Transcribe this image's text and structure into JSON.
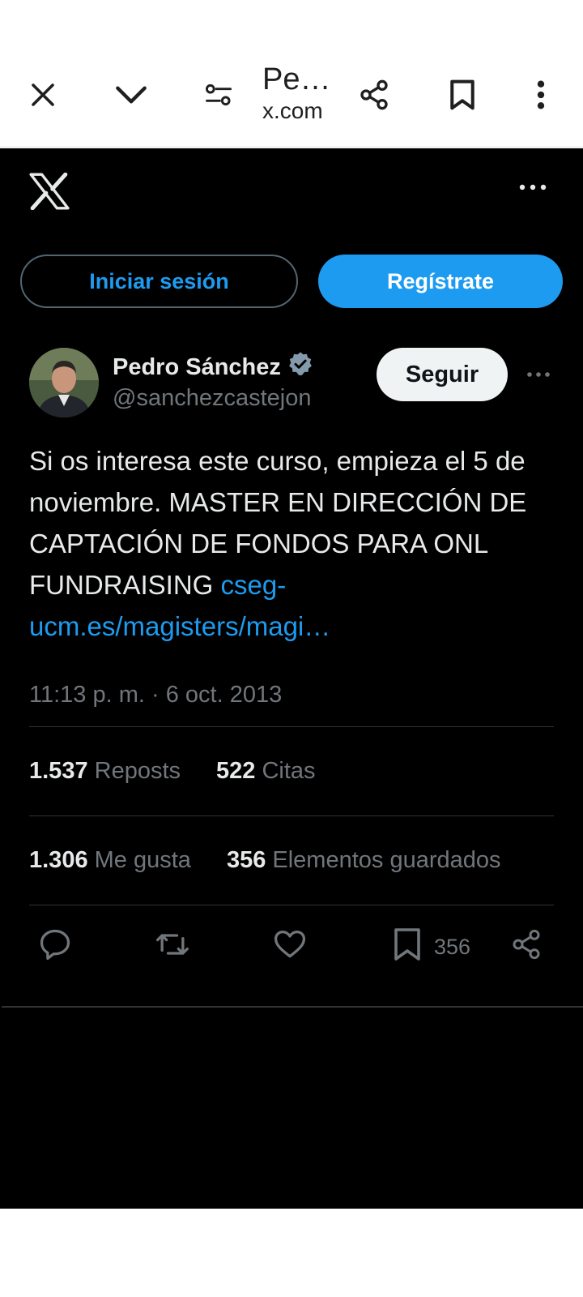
{
  "browser": {
    "title": "Pe…",
    "domain": "x.com",
    "icons": [
      "close-icon",
      "chevron-down-icon",
      "page-settings-icon",
      "share-icon",
      "bookmark-icon",
      "more-vert-icon"
    ]
  },
  "header": {
    "logo": "x-logo",
    "more": "more-horizontal-icon"
  },
  "auth": {
    "login_label": "Iniciar sesión",
    "signup_label": "Regístrate"
  },
  "tweet": {
    "author_name": "Pedro Sánchez",
    "author_handle": "@sanchezcastejon",
    "follow_label": "Seguir",
    "text": "Si os interesa este curso, empieza el 5 de noviembre. MASTER EN DIRECCIÓN DE CAPTACIÓN DE FONDOS PARA ONL FUNDRAISING ",
    "link": "cseg-ucm.es/magisters/magi…",
    "timestamp": "11:13 p. m. · 6 oct. 2013"
  },
  "stats": {
    "reposts_count": "1.537",
    "reposts_label": "Reposts",
    "quotes_count": "522",
    "quotes_label": "Citas",
    "likes_count": "1.306",
    "likes_label": "Me gusta",
    "bookmarks_count": "356",
    "bookmarks_label": "Elementos guardados"
  },
  "actions": {
    "bookmark_count": "356"
  },
  "colors": {
    "accent": "#1d9bf0",
    "background": "#000000",
    "muted": "#71767b"
  }
}
